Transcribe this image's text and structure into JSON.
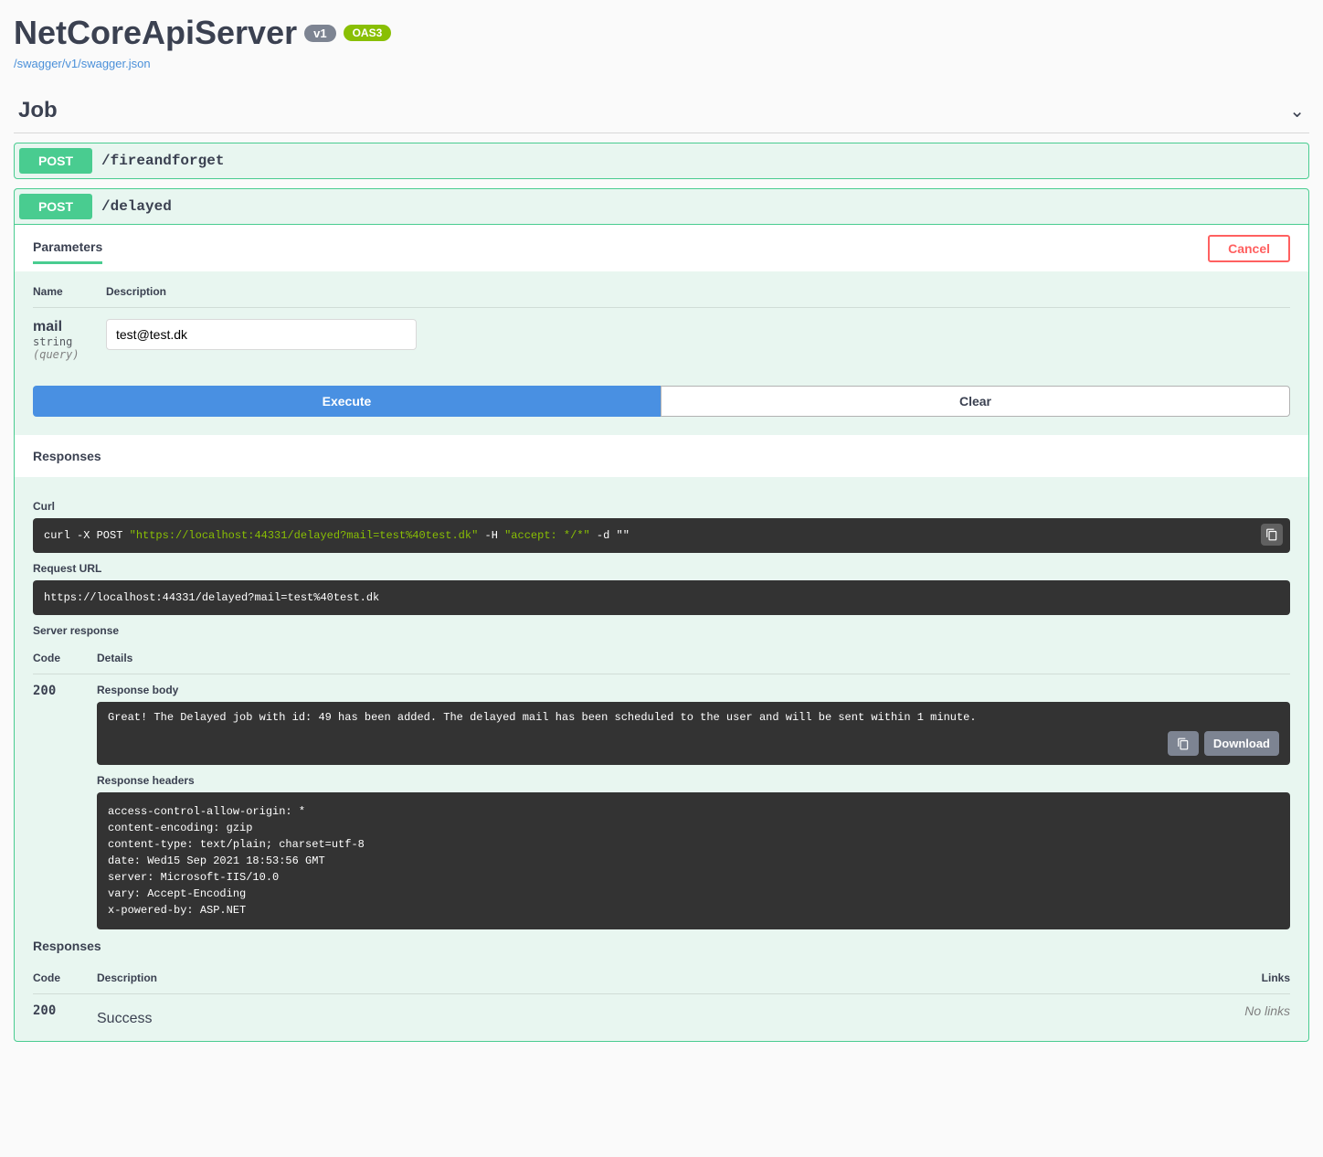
{
  "title": "NetCoreApiServer",
  "version_badge": "v1",
  "oas_badge": "OAS3",
  "spec_link": "/swagger/v1/swagger.json",
  "section": "Job",
  "op1": {
    "method": "POST",
    "path": "/fireandforget"
  },
  "op2": {
    "method": "POST",
    "path": "/delayed",
    "tab_parameters": "Parameters",
    "cancel": "Cancel",
    "head_name": "Name",
    "head_desc": "Description",
    "param": {
      "name": "mail",
      "type": "string",
      "loc": "(query)",
      "value": "test@test.dk"
    },
    "execute": "Execute",
    "clear": "Clear",
    "responses_title": "Responses",
    "curl_label": "Curl",
    "curl": {
      "pre": "curl -X POST ",
      "url": "\"https://localhost:44331/delayed?mail=test%40test.dk\"",
      "mid": " -H  ",
      "accept": "\"accept: */*\"",
      "post": " -d \"\""
    },
    "requrl_label": "Request URL",
    "requrl": "https://localhost:44331/delayed?mail=test%40test.dk",
    "server_response_label": "Server response",
    "code_label": "Code",
    "details_label": "Details",
    "code_200": "200",
    "body_label": "Response body",
    "body": {
      "p1": "Great!",
      "p2": " The Delayed job with id: ",
      "id": "49",
      "p3": " has been added. ",
      "p4": "The delayed mail has been scheduled to the user and will be sent within ",
      "min": "1",
      "p5": " minute."
    },
    "download": "Download",
    "headers_label": "Response headers",
    "headers": " access-control-allow-origin: *\n content-encoding: gzip\n content-type: text/plain; charset=utf-8\n date: Wed15 Sep 2021 18:53:56 GMT\n server: Microsoft-IIS/10.0\n vary: Accept-Encoding\n x-powered-by: ASP.NET",
    "doc_responses_label": "Responses",
    "doc_desc_label": "Description",
    "doc_links_label": "Links",
    "doc_code": "200",
    "doc_success": "Success",
    "doc_nolinks": "No links"
  }
}
